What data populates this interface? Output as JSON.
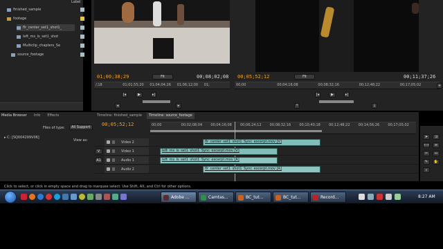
{
  "project": {
    "bin_items": [
      {
        "name": "finished_sample",
        "icon": "sequence-icon"
      },
      {
        "name": "footage",
        "icon": "folder-icon"
      },
      {
        "name": "flr_center_set1_shot1_",
        "icon": "clip-icon"
      },
      {
        "name": "left_ms_ls_set1_shot",
        "icon": "clip-icon"
      },
      {
        "name": "Multiclip_chapters_Se",
        "icon": "clip-icon"
      },
      {
        "name": "source_footage",
        "icon": "sequence-icon"
      }
    ],
    "col_header": "Label"
  },
  "source_monitor": {
    "timecode_in": "01;00;38;29",
    "fit_label": "Fit",
    "timecode_dur": "00;08;02;08",
    "ruler_ticks": [
      "/;18",
      "01;01;55;20",
      "01;04;04;26",
      "01;06;12;00",
      "01;"
    ]
  },
  "program_monitor": {
    "timecode_in": "00;05;52;12",
    "fit_label": "Fit",
    "timecode_dur": "00;11;37;26",
    "ruler_ticks": [
      "00;00",
      "00;04;16;08",
      "00;08;32;16",
      "00;12;48;22",
      "00;17;05;02"
    ]
  },
  "media_browser": {
    "tabs": [
      "Media Browser",
      "Info",
      "Effects"
    ],
    "files_of_type_label": "Files of type:",
    "files_of_type_value": "All Support",
    "view_as_label": "View as:",
    "drive": "C: [SQ004299V06]"
  },
  "timeline": {
    "tabs": [
      "Timeline: finished_sample",
      "Timeline: source_footage"
    ],
    "timecode": "00;05;52;12",
    "ruler_ticks": [
      "00;00",
      "00;02;08;04",
      "00;04;16;08",
      "00;06;24;12",
      "00;08;32;16",
      "00;10;40;18",
      "00;12;48;22",
      "00;14;56;26",
      "00;17;05;02"
    ],
    "tracks": [
      {
        "name": "Video 2",
        "label_left": "",
        "clip": "flr_center_set1_shot1_Sync_excerpt.mov [V]"
      },
      {
        "name": "Video 1",
        "label_left": "V",
        "clip": "left_ms_ls_set1_shot1_Sync_excerpt.mov [V]"
      },
      {
        "name": "Audio 1",
        "label_left": "A1",
        "clip": "left_ms_ls_set1_shot1_Sync_excerpt.mov [A]"
      },
      {
        "name": "Audio 2",
        "label_left": "",
        "clip": "flr_center_set1_shot1_Sync_excerpt.mov [A]"
      }
    ]
  },
  "status_bar": "Click to select, or click in empty space and drag to marquee select. Use Shift, Alt, and Ctrl for other options.",
  "taskbar": {
    "buttons": [
      "Adobe ...",
      "Camtas...",
      "BC_tut...",
      "BC_tut...",
      "Record..."
    ],
    "clock": "8:27 AM"
  }
}
